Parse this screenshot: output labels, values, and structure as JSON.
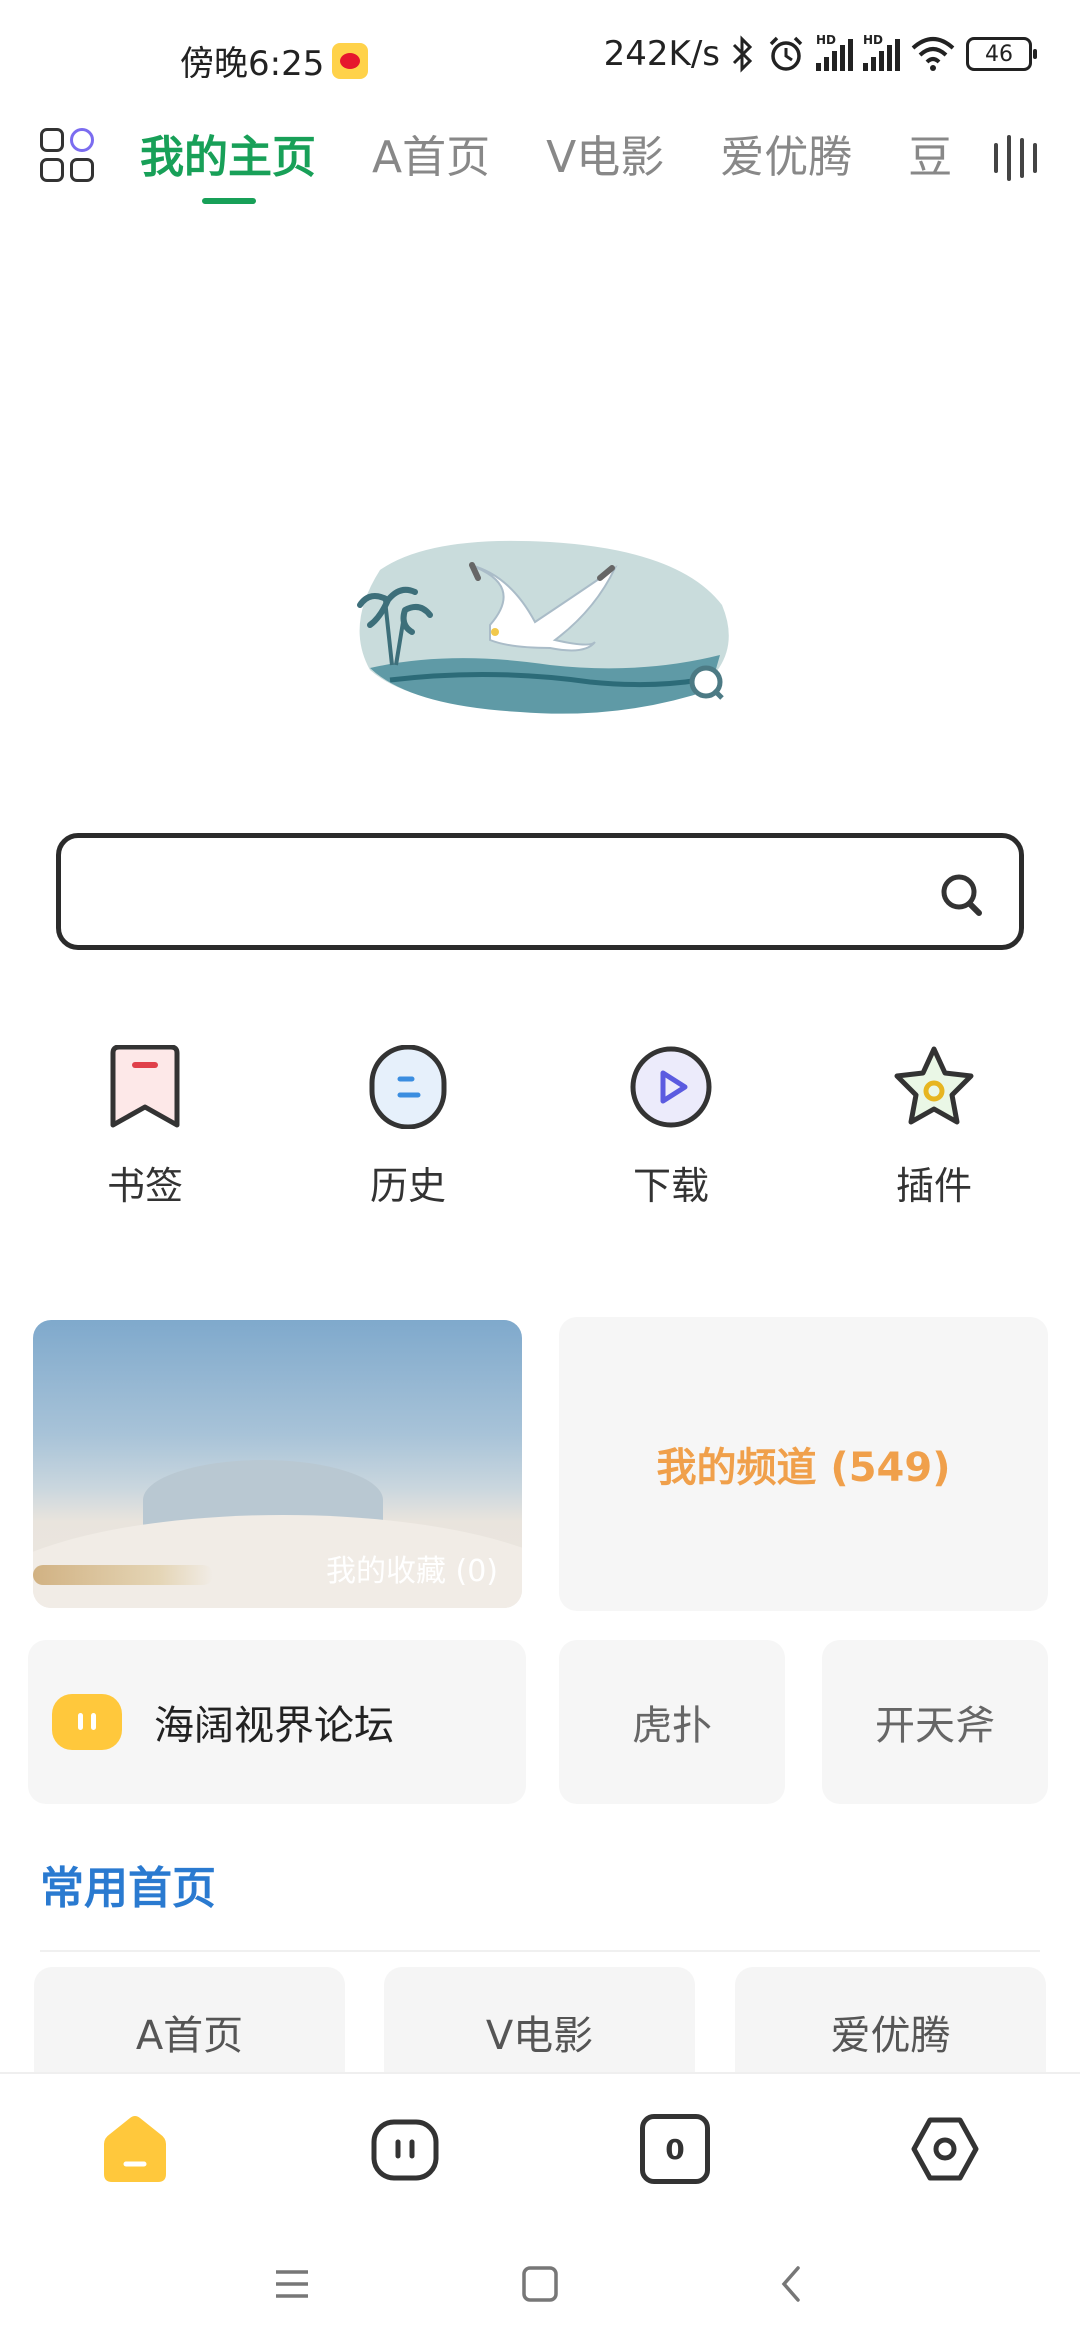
{
  "status_bar": {
    "time": "傍晚6:25",
    "net_speed": "242K/s",
    "signal1_label": "HD",
    "signal2_label": "HD",
    "battery": "46",
    "icons": [
      "weibo-icon",
      "bluetooth-icon",
      "alarm-icon",
      "signal-icon",
      "wifi-icon",
      "battery-icon"
    ]
  },
  "tabs": {
    "items": [
      {
        "label": "我的主页",
        "active": true
      },
      {
        "label": "A首页",
        "active": false
      },
      {
        "label": "V电影",
        "active": false
      },
      {
        "label": "爱优腾",
        "active": false
      },
      {
        "label": "豆",
        "active": false
      }
    ]
  },
  "search": {
    "placeholder": ""
  },
  "quick_actions": [
    {
      "label": "书签",
      "icon": "bookmark-icon"
    },
    {
      "label": "历史",
      "icon": "history-icon"
    },
    {
      "label": "下载",
      "icon": "download-icon"
    },
    {
      "label": "插件",
      "icon": "plugin-icon"
    }
  ],
  "cards": {
    "favorites": "我的收藏 (0)",
    "channels": "我的频道 (549)",
    "forum": "海阔视界论坛",
    "hupu": "虎扑",
    "kaitianfu": "开天斧"
  },
  "section": {
    "title": "常用首页"
  },
  "favorite_pages": [
    "A首页",
    "V电影",
    "爱优腾"
  ],
  "bottom_nav": [
    "home-icon",
    "square-face-icon",
    "tab-count-icon",
    "settings-icon"
  ],
  "bottom_nav_tab_count": "0",
  "colors": {
    "accent_green": "#18a058",
    "section_blue": "#2a7ad0",
    "channel_orange": "#f0a04b",
    "home_yellow": "#ffc83c"
  }
}
